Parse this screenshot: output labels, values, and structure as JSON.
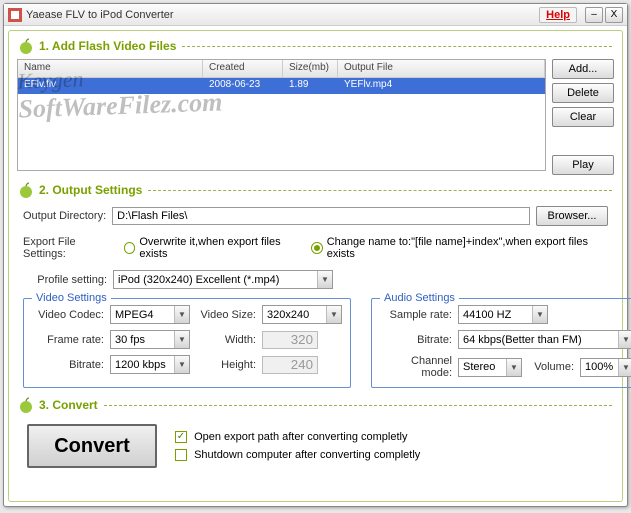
{
  "titlebar": {
    "title": "Yaease FLV to iPod Converter",
    "help": "Help",
    "minimize": "–",
    "close": "X"
  },
  "sections": {
    "s1": "1. Add Flash Video Files",
    "s2": "2. Output Settings",
    "s3": "3. Convert"
  },
  "filelist": {
    "headers": {
      "name": "Name",
      "created": "Created",
      "size": "Size(mb)",
      "output": "Output File"
    },
    "rows": [
      {
        "name": "EFlv.flv",
        "created": "2008-06-23",
        "size": "1.89",
        "output": "YEFlv.mp4"
      }
    ]
  },
  "buttons": {
    "add": "Add...",
    "delete": "Delete",
    "clear": "Clear",
    "play": "Play",
    "browser": "Browser...",
    "convert": "Convert"
  },
  "output": {
    "dir_label": "Output Directory:",
    "dir_value": "D:\\Flash Files\\",
    "export_label": "Export File Settings:",
    "overwrite": "Overwrite it,when export files exists",
    "changename": "Change name to:\"[file name]+index\",when export files exists",
    "profile_label": "Profile setting:",
    "profile_value": "iPod (320x240) Excellent (*.mp4)"
  },
  "video": {
    "legend": "Video Settings",
    "codec_label": "Video Codec:",
    "codec": "MPEG4",
    "size_label": "Video Size:",
    "size": "320x240",
    "frame_label": "Frame rate:",
    "frame": "30 fps",
    "width_label": "Width:",
    "width": "320",
    "bitrate_label": "Bitrate:",
    "bitrate": "1200 kbps",
    "height_label": "Height:",
    "height": "240"
  },
  "audio": {
    "legend": "Audio Settings",
    "sample_label": "Sample rate:",
    "sample": "44100 HZ",
    "bitrate_label": "Bitrate:",
    "bitrate": "64  kbps(Better than FM)",
    "channel_label": "Channel mode:",
    "channel": "Stereo",
    "volume_label": "Volume:",
    "volume": "100%"
  },
  "checks": {
    "openpath": "Open export path after converting completly",
    "shutdown": "Shutdown computer after converting completly"
  },
  "watermark": {
    "l1": "Keygen",
    "l2": "SoftWareFilez.com"
  }
}
